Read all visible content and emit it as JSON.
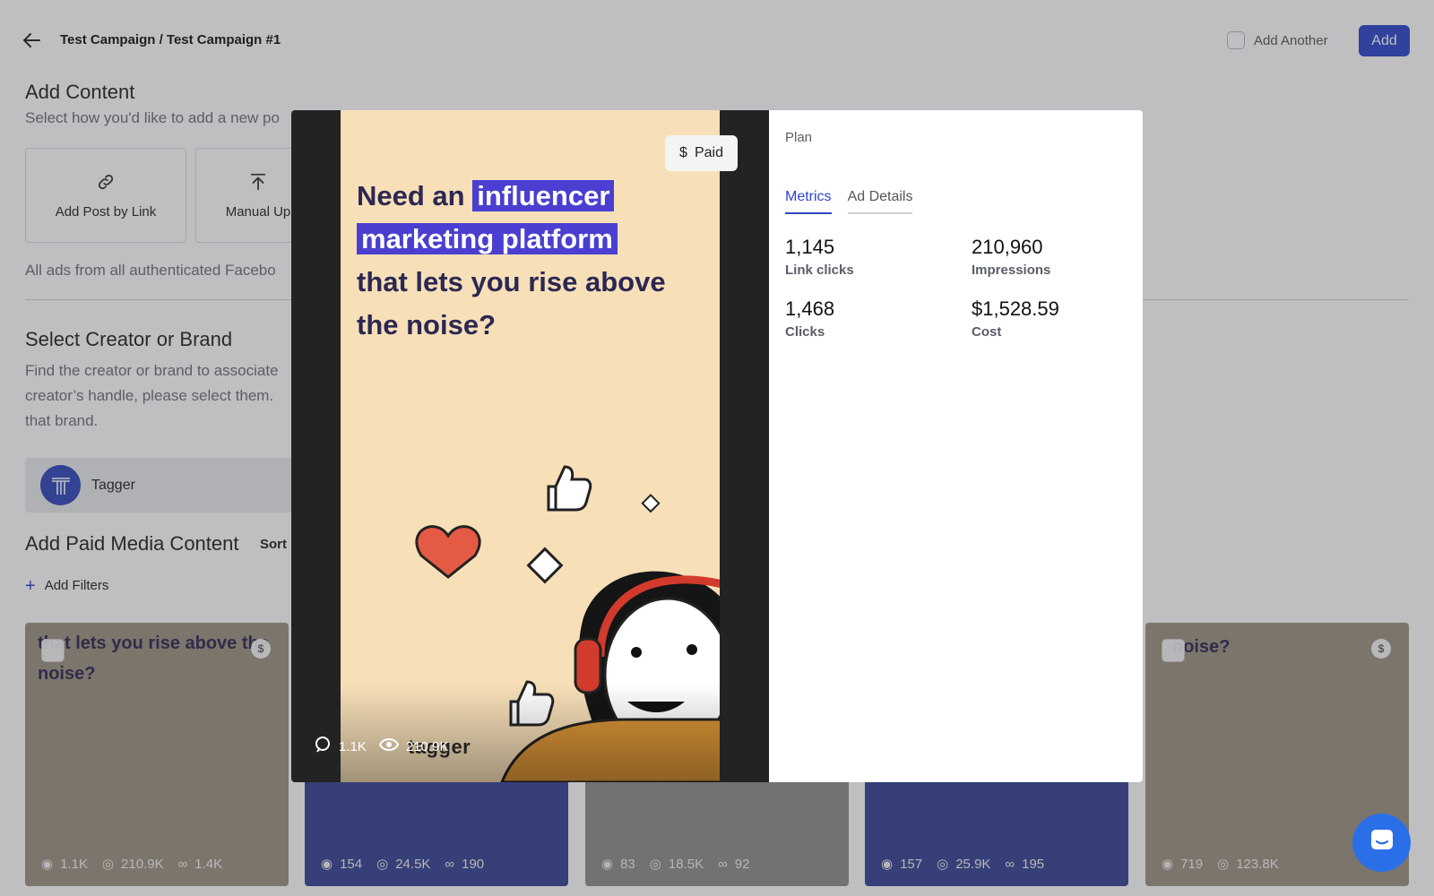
{
  "header": {
    "breadcrumb": "Test Campaign / Test Campaign #1",
    "add_another_label": "Add Another",
    "add_button_label": "Add"
  },
  "add_content": {
    "title": "Add Content",
    "subtitle": "Select how you'd like to add a new po",
    "options": [
      {
        "label": "Add Post by Link",
        "icon": "link-icon"
      },
      {
        "label": "Manual Up",
        "icon": "upload-icon"
      }
    ],
    "note": "All ads from all authenticated Facebo"
  },
  "creator": {
    "title": "Select Creator or Brand",
    "description_lines": [
      "Find the creator or brand to associate",
      "creator’s handle, please select them.",
      "that brand."
    ],
    "selected_name": "Tagger"
  },
  "paid_media": {
    "title": "Add Paid Media Content",
    "sort_label": "Sort",
    "filters_label": "Add Filters",
    "thumbnails": [
      {
        "text": "that lets you rise above the noise?",
        "comments": "1.1K",
        "views": "210.9K",
        "links": "1.4K",
        "bg": "#8e8677"
      },
      {
        "text": "",
        "comments": "154",
        "views": "24.5K",
        "links": "190",
        "bg": "#2f3a8a"
      },
      {
        "text": "",
        "comments": "83",
        "views": "18.5K",
        "links": "92",
        "bg": "#8a8a8a"
      },
      {
        "text": "",
        "comments": "157",
        "views": "25.9K",
        "links": "195",
        "bg": "#2f3a8a"
      },
      {
        "text": "noise?",
        "comments": "719",
        "views": "123.8K",
        "links": "",
        "bg": "#8e8677"
      }
    ]
  },
  "modal": {
    "paid_badge": "Paid",
    "headline_highlight_1": "influencer",
    "headline_highlight_2": "marketing platform",
    "headline_pre": "Need an",
    "headline_post": "that lets you rise above the noise?",
    "brand_logo_text": "tagger",
    "media_comments": "1.1K",
    "media_views": "210.9K",
    "plan_label": "Plan",
    "tabs": [
      {
        "label": "Metrics",
        "active": true
      },
      {
        "label": "Ad Details",
        "active": false
      }
    ],
    "metrics": [
      {
        "value": "1,145",
        "label": "Link clicks"
      },
      {
        "value": "210,960",
        "label": "Impressions"
      },
      {
        "value": "1,468",
        "label": "Clicks"
      },
      {
        "value": "$1,528.59",
        "label": "Cost"
      }
    ]
  },
  "colors": {
    "accent": "#2b45c8",
    "overlay": "rgba(60,62,70,0.33)",
    "creative_bg": "#f7dfb8",
    "highlight": "#4a3fd0"
  }
}
